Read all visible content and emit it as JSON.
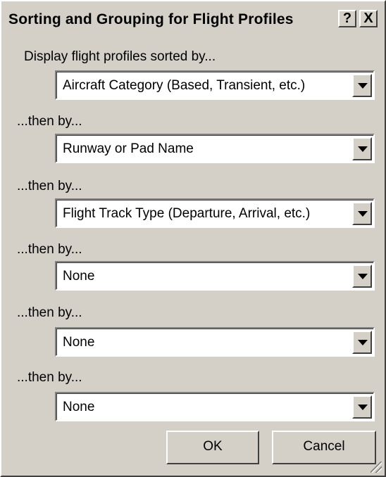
{
  "dialog": {
    "title": "Sorting and Grouping for Flight Profiles",
    "help_label": "?",
    "close_label": "X"
  },
  "sorts": [
    {
      "label": "Display flight profiles sorted by...",
      "value": "Aircraft Category  (Based, Transient, etc.)"
    },
    {
      "label": "...then by...",
      "value": "Runway or Pad Name"
    },
    {
      "label": "...then by...",
      "value": "Flight Track Type  (Departure, Arrival, etc.)"
    },
    {
      "label": "...then by...",
      "value": "None"
    },
    {
      "label": "...then by...",
      "value": "None"
    },
    {
      "label": "...then by...",
      "value": "None"
    }
  ],
  "buttons": {
    "ok": "OK",
    "cancel": "Cancel"
  },
  "icons": {
    "dropdown": "chevron-down-icon",
    "resize": "resize-grip-icon"
  }
}
